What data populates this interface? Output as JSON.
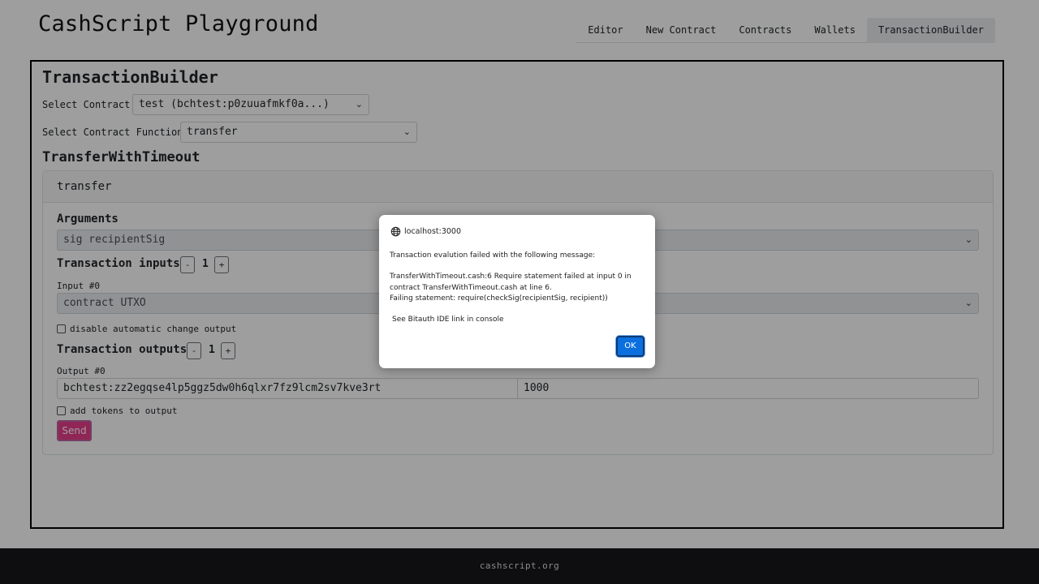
{
  "header": {
    "title": "CashScript Playground",
    "nav": [
      "Editor",
      "New Contract",
      "Contracts",
      "Wallets",
      "TransactionBuilder"
    ],
    "active_tab": "TransactionBuilder"
  },
  "builder": {
    "title": "TransactionBuilder",
    "select_contract_label": "Select Contract:",
    "select_contract_value": "test (bchtest:p0zuuafmkf0a...)",
    "select_function_label": "Select Contract Function:",
    "select_function_value": "transfer",
    "contract_name": "TransferWithTimeout",
    "card": {
      "header": "transfer",
      "arguments_label": "Arguments",
      "argument_placeholder": "sig recipientSig",
      "inputs_label": "Transaction inputs",
      "inputs_count": "1",
      "input_label": "Input #0",
      "input_value": "contract UTXO",
      "disable_change_label": "disable automatic change output",
      "outputs_label": "Transaction outputs",
      "outputs_count": "1",
      "output_label": "Output #0",
      "output_address": "bchtest:zz2egqse4lp5ggz5dw0h6qlxr7fz9lcm2sv7kve3rt",
      "output_amount": "1000",
      "add_tokens_label": "add tokens to output",
      "send_label": "Send",
      "minus": "-",
      "plus": "+"
    }
  },
  "footer": {
    "text": "cashscript.org"
  },
  "dialog": {
    "origin": "localhost:3000",
    "line1": "Transaction evalution failed with the following message:",
    "line2": "TransferWithTimeout.cash:6 Require statement failed at input 0 in",
    "line3": "contract TransferWithTimeout.cash at line 6.",
    "line4": "Failing statement: require(checkSig(recipientSig, recipient))",
    "line5": "See Bitauth IDE link in console",
    "ok_label": "OK"
  },
  "colors": {
    "accent": "#e83e8c",
    "ok_button": "#0b6fde",
    "footer_bg": "#17171b"
  },
  "icons": {
    "origin": "globe-icon",
    "select": "chevron-down-icon"
  }
}
